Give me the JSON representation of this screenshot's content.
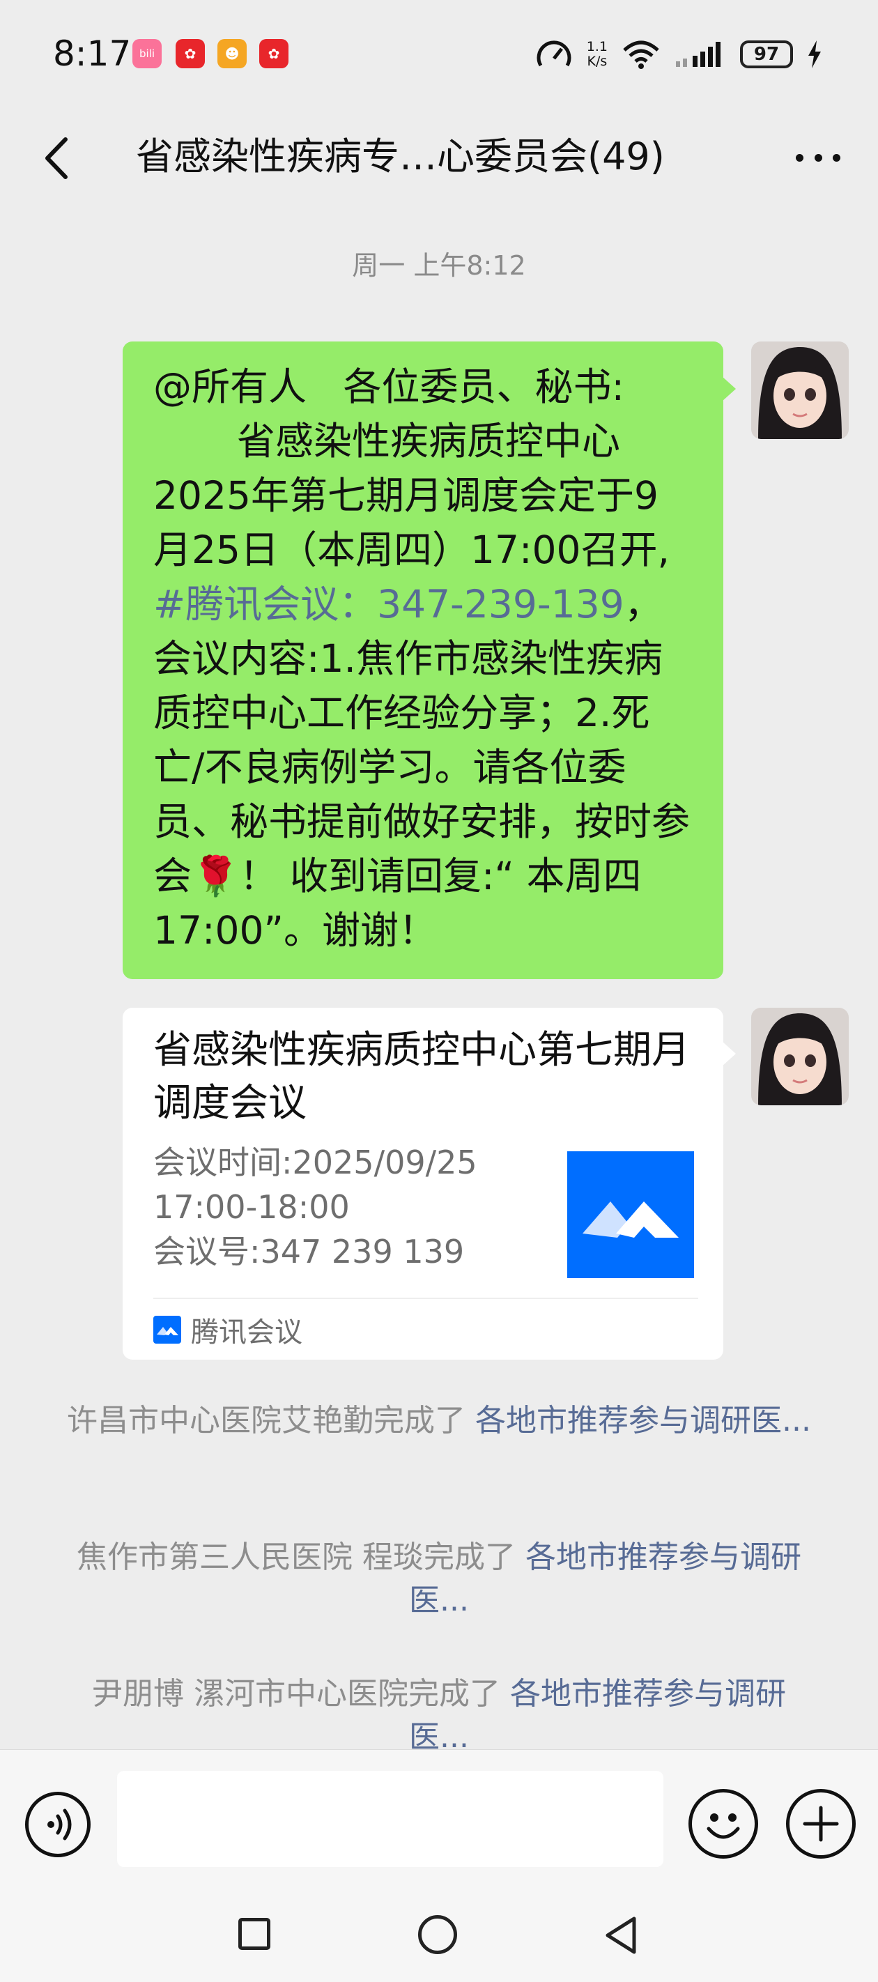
{
  "status_bar": {
    "time": "8:17",
    "net_speed_value": "1.1",
    "net_speed_unit": "K/s",
    "battery": "97",
    "app_icons": [
      {
        "name": "bilibili-icon",
        "color": "#fb7299",
        "glyph": "bili"
      },
      {
        "name": "app-red-icon-1",
        "color": "#e8262b",
        "glyph": "◉"
      },
      {
        "name": "app-monkey-icon",
        "color": "#f5a623",
        "glyph": "◕"
      },
      {
        "name": "app-red-icon-2",
        "color": "#e8262b",
        "glyph": "◉"
      }
    ]
  },
  "header": {
    "title": "省感染性疾病专…心委员会(49)"
  },
  "chat": {
    "time_separator": "周一 上午8:12",
    "message": {
      "mention": "@所有人",
      "greeting": "各位委员、秘书:",
      "body_before_link": "省感染性疾病质控中心2025年第七期月调度会定于9月25日（本周四）17:00召开,",
      "link_text": "#腾讯会议：347-239-139",
      "body_after_link": "，会议内容:1.焦作市感染性疾病质控中心工作经验分享；2.死亡/不良病例学习。请各位委员、秘书提前做好安排，按时参会",
      "emoji": "🌹",
      "closing": "！ 收到请回复:“ 本周四17:00”。谢谢！"
    },
    "meeting_card": {
      "title": "省感染性疾病质控中心第七期月调度会议",
      "time_line": "会议时间:2025/09/25",
      "time_range": "17:00-18:00",
      "meeting_id": "会议号:347 239 139",
      "source": "腾讯会议",
      "logo_color": "#006eff"
    },
    "notices": [
      {
        "text": "许昌市中心医院艾艳勤完成了 ",
        "link": "各地市推荐参与调研医..."
      },
      {
        "text": "焦作市第三人民医院 程琰完成了 ",
        "link": "各地市推荐参与调研医..."
      },
      {
        "text": "尹朋博 漯河市中心医院完成了 ",
        "link": "各地市推荐参与调研医..."
      }
    ]
  },
  "input_bar": {
    "placeholder": ""
  },
  "colors": {
    "background": "#ededed",
    "bubble": "#95ec69",
    "link": "#576b95"
  }
}
